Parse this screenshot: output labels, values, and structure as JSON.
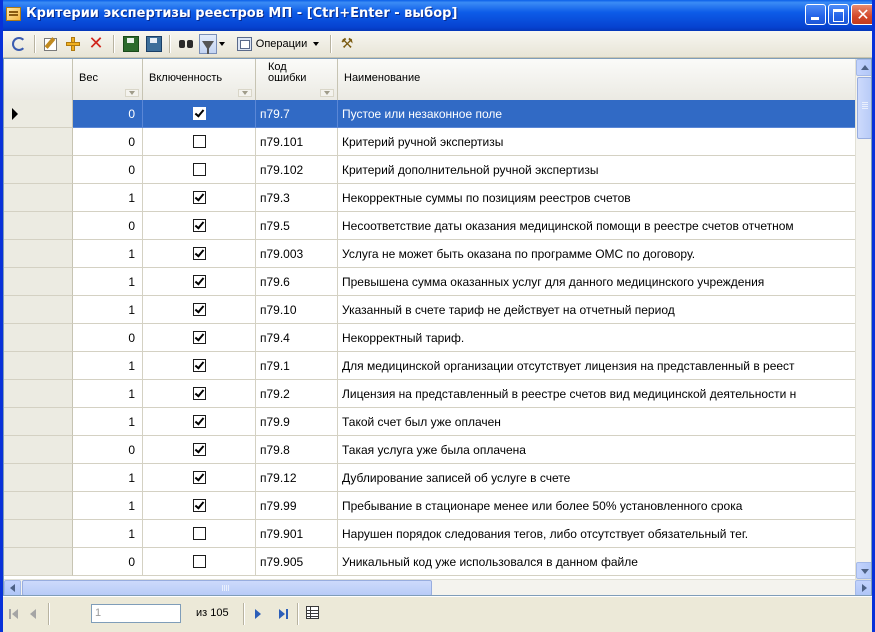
{
  "window": {
    "title": "Критерии экспертизы реестров МП - [Ctrl+Enter - выбор]"
  },
  "toolbar": {
    "items": [
      "refresh-icon",
      "edit-icon",
      "add-icon",
      "delete-icon",
      "save-icon",
      "save-all-icon",
      "find-icon",
      "filter-icon"
    ],
    "operations_label": "Операции"
  },
  "grid": {
    "columns": {
      "weight": "Вес",
      "included": "Включенность",
      "code_line1": "Код",
      "code_line2": "ошибки",
      "name": "Наименование"
    },
    "selected_row_index": 0,
    "rows": [
      {
        "weight": "0",
        "included": true,
        "code": "п79.7",
        "name": "Пустое или незаконное поле"
      },
      {
        "weight": "0",
        "included": false,
        "code": "п79.101",
        "name": "Критерий ручной экспертизы"
      },
      {
        "weight": "0",
        "included": false,
        "code": "п79.102",
        "name": "Критерий дополнительной ручной экспертизы"
      },
      {
        "weight": "1",
        "included": true,
        "code": "п79.3",
        "name": "Некорректные суммы по позициям реестров счетов"
      },
      {
        "weight": "0",
        "included": true,
        "code": "п79.5",
        "name": "Несоответствие даты оказания медицинской помощи в реестре счетов отчетном"
      },
      {
        "weight": "1",
        "included": true,
        "code": "п79.003",
        "name": "Услуга не может быть оказана по программе ОМС по договору."
      },
      {
        "weight": "1",
        "included": true,
        "code": "п79.6",
        "name": "Превышена сумма оказанных услуг для данного медицинского учреждения"
      },
      {
        "weight": "1",
        "included": true,
        "code": "п79.10",
        "name": "Указанный в счете тариф не действует на отчетный период"
      },
      {
        "weight": "0",
        "included": true,
        "code": "п79.4",
        "name": "Некорректный тариф."
      },
      {
        "weight": "1",
        "included": true,
        "code": "п79.1",
        "name": "Для медицинской организации отсутствует лицензия на представленный в реест"
      },
      {
        "weight": "1",
        "included": true,
        "code": "п79.2",
        "name": "Лицензия на представленный в реестре счетов вид медицинской деятельности н"
      },
      {
        "weight": "1",
        "included": true,
        "code": "п79.9",
        "name": "Такой счет был уже оплачен"
      },
      {
        "weight": "0",
        "included": true,
        "code": "п79.8",
        "name": "Такая услуга уже была оплачена"
      },
      {
        "weight": "1",
        "included": true,
        "code": "п79.12",
        "name": "Дублирование записей об услуге в счете"
      },
      {
        "weight": "1",
        "included": true,
        "code": "п79.99",
        "name": "Пребывание в стационаре менее или более 50% установленного срока"
      },
      {
        "weight": "1",
        "included": false,
        "code": "п79.901",
        "name": "Нарушен порядок следования тегов, либо отсутствует обязательный тег."
      },
      {
        "weight": "0",
        "included": false,
        "code": "п79.905",
        "name": "Уникальный код уже использовался в данном файле"
      }
    ]
  },
  "navigator": {
    "position": "1",
    "of_count": "из 105"
  }
}
